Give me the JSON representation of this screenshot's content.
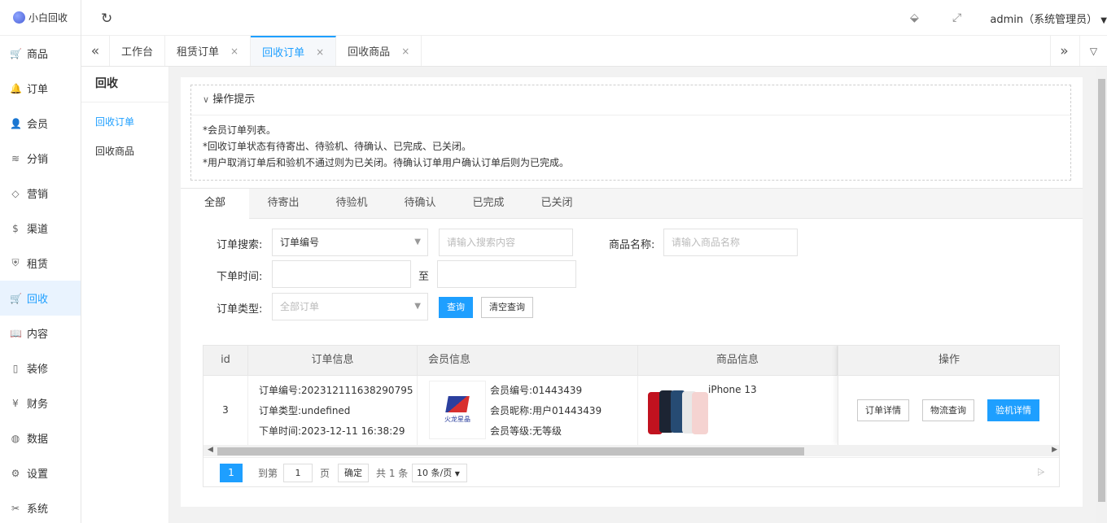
{
  "brand": {
    "name": "小白回收"
  },
  "sidebar": {
    "items": [
      {
        "label": "商品",
        "icon": "cart-icon",
        "glyph": "🛒"
      },
      {
        "label": "订单",
        "icon": "bell-icon",
        "glyph": "🔔"
      },
      {
        "label": "会员",
        "icon": "user-icon",
        "glyph": "👤"
      },
      {
        "label": "分销",
        "icon": "layers-icon",
        "glyph": "≋"
      },
      {
        "label": "营销",
        "icon": "diamond-icon",
        "glyph": "◇"
      },
      {
        "label": "渠道",
        "icon": "dollar-icon",
        "glyph": "$"
      },
      {
        "label": "租赁",
        "icon": "shield-icon",
        "glyph": "⛨"
      },
      {
        "label": "回收",
        "icon": "cart-icon",
        "glyph": "🛒",
        "active": true
      },
      {
        "label": "内容",
        "icon": "book-icon",
        "glyph": "📖"
      },
      {
        "label": "装修",
        "icon": "document-icon",
        "glyph": "▯"
      },
      {
        "label": "财务",
        "icon": "yen-icon",
        "glyph": "¥"
      },
      {
        "label": "数据",
        "icon": "globe-icon",
        "glyph": "◍"
      },
      {
        "label": "设置",
        "icon": "gear-icon",
        "glyph": "⚙"
      },
      {
        "label": "系统",
        "icon": "tools-icon",
        "glyph": "✂"
      }
    ]
  },
  "header": {
    "user": "admin（系统管理员）"
  },
  "tabbar": {
    "tabs": [
      {
        "label": "工作台",
        "closable": false
      },
      {
        "label": "租赁订单",
        "closable": true
      },
      {
        "label": "回收订单",
        "closable": true,
        "active": true
      },
      {
        "label": "回收商品",
        "closable": true
      }
    ]
  },
  "subsidebar": {
    "title": "回收",
    "items": [
      {
        "label": "回收订单",
        "active": true
      },
      {
        "label": "回收商品"
      }
    ]
  },
  "tips": {
    "title": "操作提示",
    "lines": [
      "*会员订单列表。",
      "*回收订单状态有待寄出、待验机、待确认、已完成、已关闭。",
      "*用户取消订单后和验机不通过则为已关闭。待确认订单用户确认订单后则为已完成。"
    ]
  },
  "filter_tabs": [
    "全部",
    "待寄出",
    "待验机",
    "待确认",
    "已完成",
    "已关闭"
  ],
  "search": {
    "order_search_label": "订单搜索:",
    "order_search_select": "订单编号",
    "search_placeholder": "请输入搜索内容",
    "goods_name_label": "商品名称:",
    "goods_name_placeholder": "请输入商品名称",
    "order_time_label": "下单时间:",
    "to_label": "至",
    "order_type_label": "订单类型:",
    "order_type_placeholder": "全部订单",
    "query_button": "查询",
    "clear_button": "清空查询"
  },
  "table": {
    "headers": [
      "id",
      "订单信息",
      "会员信息",
      "商品信息",
      "操作"
    ],
    "rows": [
      {
        "id": "3",
        "order_no": "订单编号:202312111638290795",
        "order_type": "订单类型:undefined",
        "order_time": "下单时间:2023-12-11 16:38:29",
        "member_no": "会员编号:01443439",
        "member_nick": "会员昵称:用户01443439",
        "member_level": "会员等级:无等级",
        "avatar_text": "火龙星晶",
        "product_name": "iPhone 13",
        "ops": [
          "订单详情",
          "物流查询",
          "验机详情"
        ]
      }
    ]
  },
  "pagination": {
    "current": "1",
    "goto_label": "到第",
    "goto_value": "1",
    "page_label": "页",
    "confirm": "确定",
    "total": "共 1 条",
    "per_page": "10 条/页"
  },
  "colors": {
    "accent": "#1e9fff",
    "active_bg": "#e9f3fe"
  }
}
